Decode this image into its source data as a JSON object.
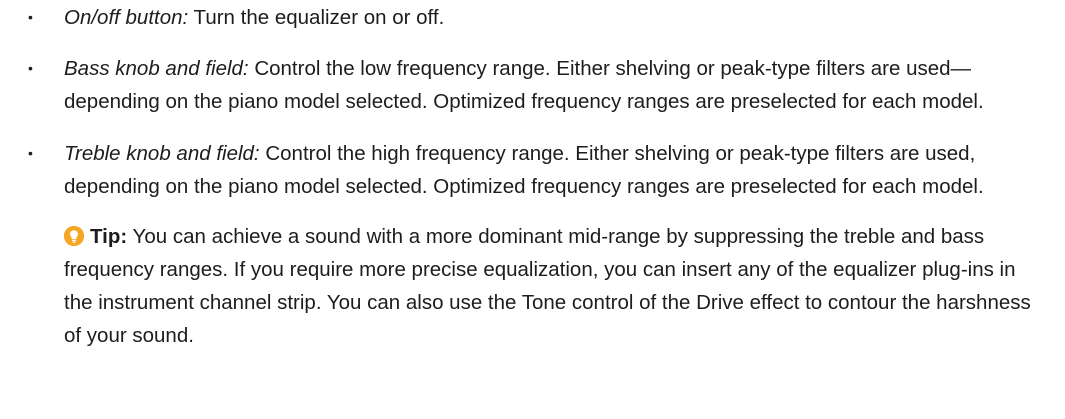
{
  "items": [
    {
      "bullet": "•",
      "term": "On/off button:",
      "text": " Turn the equalizer on or off."
    },
    {
      "bullet": "•",
      "term": "Bass knob and field:",
      "text": " Control the low frequency range. Either shelving or peak-type filters are used—depending on the piano model selected. Optimized frequency ranges are preselected for each model."
    },
    {
      "bullet": "•",
      "term": "Treble knob and field:",
      "text": " Control the high frequency range. Either shelving or peak-type filters are used, depending on the piano model selected. Optimized frequency ranges are preselected for each model."
    }
  ],
  "tip": {
    "label": "Tip:",
    "text": " You can achieve a sound with a more dominant mid-range by suppressing the treble and bass frequency ranges. If you require more precise equalization, you can insert any of the equalizer plug-ins in the instrument channel strip. You can also use the Tone control of the Drive effect to contour the harshness of your sound."
  },
  "colors": {
    "text": "#1d1d1f",
    "tip_icon": "#f5a623"
  },
  "icons": {
    "tip": "lightbulb-icon"
  }
}
